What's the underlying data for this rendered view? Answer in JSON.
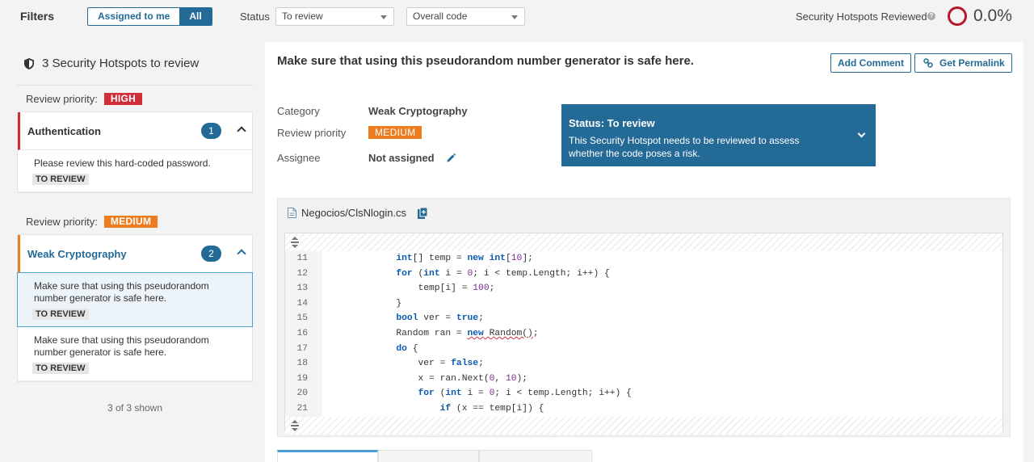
{
  "filters": {
    "label": "Filters",
    "assigned_label": "Assigned to me",
    "all_label": "All",
    "status_label": "Status",
    "status_value": "To review",
    "code_value": "Overall code",
    "reviewed_label": "Security Hotspots Reviewed",
    "reviewed_pct": "0.0%"
  },
  "sidebar": {
    "title": "3 Security Hotspots to review",
    "priority_label": "Review priority:",
    "high_badge": "HIGH",
    "medium_badge": "MEDIUM",
    "groups": [
      {
        "name": "Authentication",
        "count": "1",
        "items": [
          {
            "text": "Please review this hard-coded password.",
            "tag": "TO REVIEW"
          }
        ]
      },
      {
        "name": "Weak Cryptography",
        "count": "2",
        "items": [
          {
            "text": "Make sure that using this pseudorandom number generator is safe here.",
            "tag": "TO REVIEW"
          },
          {
            "text": "Make sure that using this pseudorandom number generator is safe here.",
            "tag": "TO REVIEW"
          }
        ]
      }
    ],
    "shown": "3 of 3 shown"
  },
  "hotspot": {
    "title": "Make sure that using this pseudorandom number generator is safe here.",
    "add_comment": "Add Comment",
    "permalink": "Get Permalink",
    "category_label": "Category",
    "category_value": "Weak Cryptography",
    "priority_label": "Review priority",
    "priority_value": "MEDIUM",
    "assignee_label": "Assignee",
    "assignee_value": "Not assigned",
    "status_title": "Status: To review",
    "status_desc": "This Security Hotspot needs to be reviewed to assess whether the code poses a risk."
  },
  "code": {
    "file": "Negocios/ClsNlogin.cs",
    "lines": [
      {
        "n": "11",
        "t": "            int[] temp = new int[10];"
      },
      {
        "n": "12",
        "t": "            for (int i = 0; i < temp.Length; i++) {"
      },
      {
        "n": "13",
        "t": "                temp[i] = 100;"
      },
      {
        "n": "14",
        "t": "            }"
      },
      {
        "n": "15",
        "t": "            bool ver = true;"
      },
      {
        "n": "16",
        "t": "            Random ran = new Random();"
      },
      {
        "n": "17",
        "t": "            do {"
      },
      {
        "n": "18",
        "t": "                ver = false;"
      },
      {
        "n": "19",
        "t": "                x = ran.Next(0, 10);"
      },
      {
        "n": "20",
        "t": "                for (int i = 0; i < temp.Length; i++) {"
      },
      {
        "n": "21",
        "t": "                    if (x == temp[i]) {"
      }
    ]
  },
  "colors": {
    "primary": "#236a97",
    "high": "#d02f3a",
    "medium": "#ed7d20"
  },
  "icons": [
    "shield-icon",
    "chevron-up-icon",
    "link-icon",
    "pencil-icon",
    "chevron-down-icon",
    "file-icon",
    "copy-icon",
    "expand-icon",
    "help-icon",
    "ring-icon"
  ]
}
